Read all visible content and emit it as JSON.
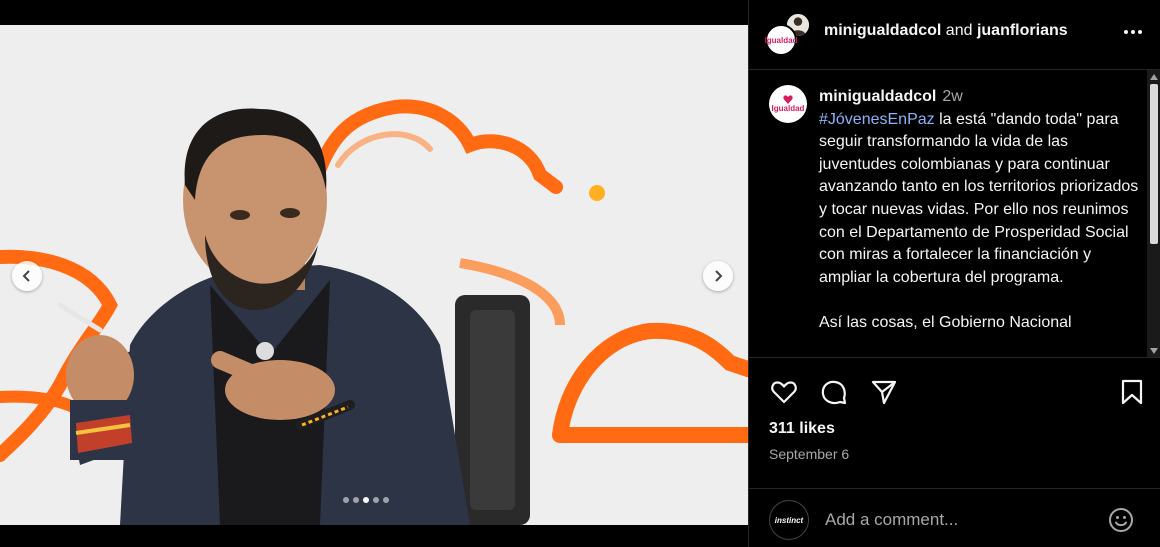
{
  "post": {
    "author": "minigualdadcol",
    "coauthor": "juanflorians",
    "joiner": "and",
    "avatar_text": "Igualdad",
    "slides_total": 5,
    "slide_active": 3
  },
  "caption": {
    "username": "minigualdadcol",
    "time": "2w",
    "hashtag": "#JóvenesEnPaz",
    "body": " la está \"dando toda\" para seguir transformando la vida de las juventudes colombianas y para continuar avanzando tanto en los territorios priorizados y tocar nuevas vidas. Por ello nos reunimos con el Departamento de Prosperidad Social con miras a fortalecer la financiación y ampliar la cobertura del programa.",
    "body2": "Así las cosas, el Gobierno Nacional"
  },
  "stats": {
    "likes": "311 likes",
    "date": "September 6"
  },
  "comment": {
    "placeholder": "Add a comment...",
    "avatar_text": "instinct"
  },
  "colors": {
    "accent_orange": "#ff6a13",
    "link_blue": "#8ab4f8",
    "muted_text": "#a8a8a8"
  },
  "icons": [
    "chevron-left-icon",
    "chevron-right-icon",
    "more-icon",
    "heart-icon",
    "comment-icon",
    "share-icon",
    "bookmark-icon",
    "emoji-icon"
  ]
}
